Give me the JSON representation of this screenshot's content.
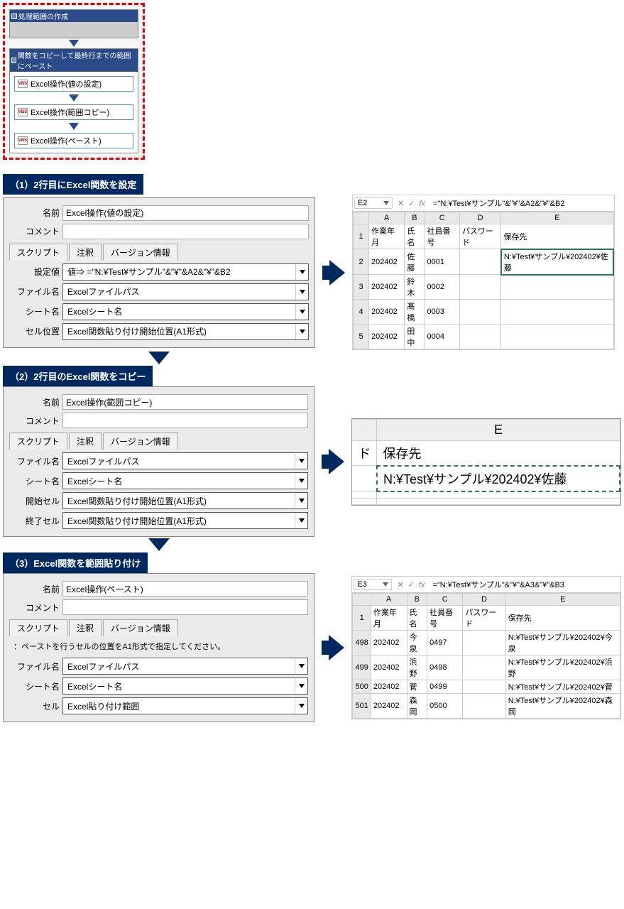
{
  "flow": {
    "box1_title": "処理範囲の作成",
    "box2_title": "関数をコピーして最終行までの範囲にペースト",
    "n1": "Excel操作(値の設定)",
    "n2": "Excel操作(範囲コピー)",
    "n3": "Excel操作(ペースト)"
  },
  "sec1": {
    "title": "（1）2行目にExcel関数を設定",
    "name_lbl": "名前",
    "name_val": "Excel操作(値の設定)",
    "comment_lbl": "コメント",
    "tab_script": "スクリプト",
    "tab_note": "注釈",
    "tab_ver": "バージョン情報",
    "f1_lbl": "設定値",
    "f1_val": "値⇒  =\"N:¥Test¥サンプル\"&\"¥\"&A2&\"¥\"&B2",
    "f2_lbl": "ファイル名",
    "f2_val": "Excelファイルパス",
    "f3_lbl": "シート名",
    "f3_val": "Excelシート名",
    "f4_lbl": "セル位置",
    "f4_val": "Excel関数貼り付け開始位置(A1形式)"
  },
  "xl1": {
    "ref": "E2",
    "formula": "=\"N:¥Test¥サンプル\"&\"¥\"&A2&\"¥\"&B2",
    "cols": [
      "A",
      "B",
      "C",
      "D",
      "E"
    ],
    "h": [
      "作業年月",
      "氏名",
      "社員番号",
      "パスワード",
      "保存先"
    ],
    "rows": [
      [
        "2",
        "202402",
        "佐藤",
        "0001",
        "",
        "N:¥Test¥サンプル¥202402¥佐藤"
      ],
      [
        "3",
        "202402",
        "鈴木",
        "0002",
        "",
        ""
      ],
      [
        "4",
        "202402",
        "髙橋",
        "0003",
        "",
        ""
      ],
      [
        "5",
        "202402",
        "田中",
        "0004",
        "",
        ""
      ]
    ]
  },
  "sec2": {
    "title": "（2）2行目のExcel関数をコピー",
    "name_val": "Excel操作(範囲コピー)",
    "f1_lbl": "ファイル名",
    "f1_val": "Excelファイルパス",
    "f2_lbl": "シート名",
    "f2_val": "Excelシート名",
    "f3_lbl": "開始セル",
    "f3_val": "Excel関数貼り付け開始位置(A1形式)",
    "f4_lbl": "終了セル",
    "f4_val": "Excel関数貼り付け開始位置(A1形式)"
  },
  "zoom": {
    "col": "E",
    "d_partial": "ド",
    "h": "保存先",
    "val": "N:¥Test¥サンプル¥202402¥佐藤"
  },
  "sec3": {
    "title": "（3）Excel関数を範囲貼り付け",
    "name_val": "Excel操作(ペースト)",
    "note": "：ペーストを行うセルの位置をA1形式で指定してください。",
    "f1_lbl": "ファイル名",
    "f1_val": "Excelファイルパス",
    "f2_lbl": "シート名",
    "f2_val": "Excelシート名",
    "f3_lbl": "セル",
    "f3_val": "Excel貼り付け範囲"
  },
  "xl3": {
    "ref": "E3",
    "formula": "=\"N:¥Test¥サンプル\"&\"¥\"&A3&\"¥\"&B3",
    "cols": [
      "A",
      "B",
      "C",
      "D",
      "E"
    ],
    "h": [
      "作業年月",
      "氏名",
      "社員番号",
      "パスワード",
      "保存先"
    ],
    "rows": [
      [
        "498",
        "202402",
        "今泉",
        "0497",
        "",
        "N:¥Test¥サンプル¥202402¥今泉"
      ],
      [
        "499",
        "202402",
        "浜野",
        "0498",
        "",
        "N:¥Test¥サンプル¥202402¥浜野"
      ],
      [
        "500",
        "202402",
        "菅",
        "0499",
        "",
        "N:¥Test¥サンプル¥202402¥菅"
      ],
      [
        "501",
        "202402",
        "森岡",
        "0500",
        "",
        "N:¥Test¥サンプル¥202402¥森岡"
      ]
    ]
  }
}
